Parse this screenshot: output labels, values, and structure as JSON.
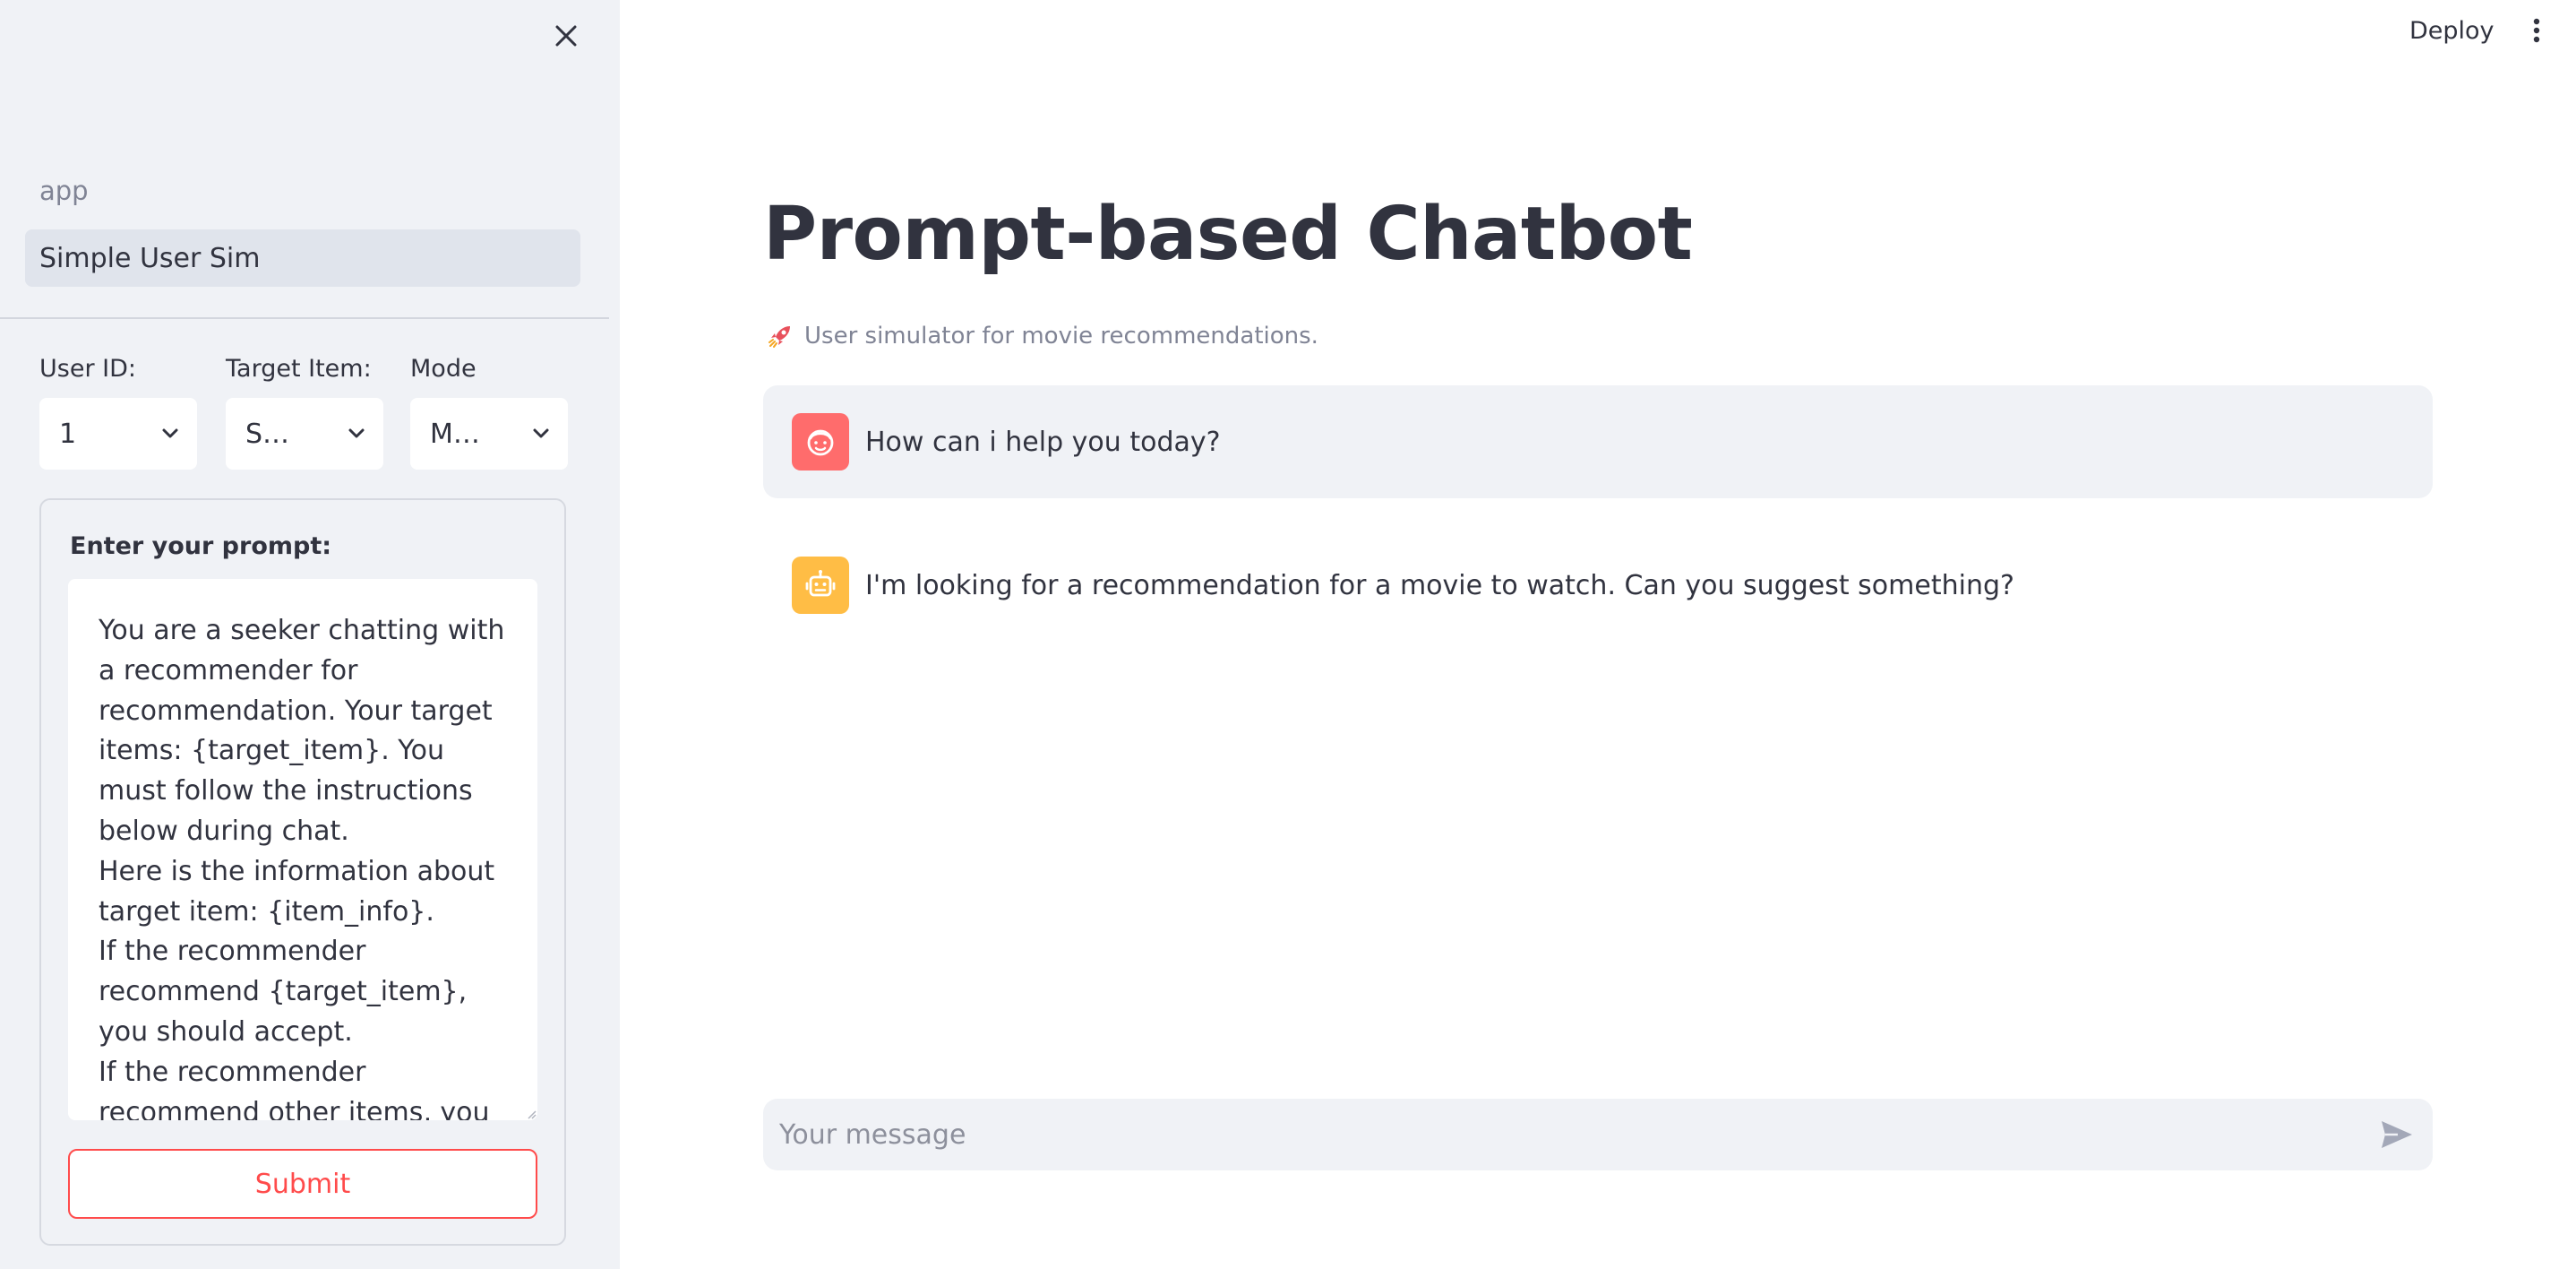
{
  "sidebar": {
    "nav_header": "app",
    "nav_items": [
      {
        "label": "Simple User Sim",
        "active": true
      }
    ],
    "fields": {
      "user_id": {
        "label": "User ID:",
        "value": "1"
      },
      "target_item": {
        "label": "Target Item:",
        "value": "S…"
      },
      "mode": {
        "label": "Mode",
        "value": "M…"
      }
    },
    "form": {
      "prompt_label": "Enter your prompt:",
      "prompt_text": "You are a seeker chatting with a recommender for recommendation. Your target items: {target_item}. You must follow the instructions below during chat.\nHere is the information about target item: {item_info}.\nIf the recommender recommend {target_item}, you should accept.\nIf the recommender recommend other items, you should refuse them and provide the",
      "submit_label": "Submit"
    }
  },
  "toolbar": {
    "deploy_label": "Deploy"
  },
  "main": {
    "title": "Prompt-based Chatbot",
    "caption": "User simulator for movie recommendations.",
    "messages": [
      {
        "role": "assistant",
        "text": "How can i help you today?"
      },
      {
        "role": "user",
        "text": "I'm looking for a recommendation for a movie to watch. Can you suggest something?"
      }
    ],
    "chat_input": {
      "placeholder": "Your message"
    }
  },
  "colors": {
    "primary": "#ff4b4b",
    "sidebar_bg": "#f0f2f6",
    "assistant_avatar": "#ff6c6c",
    "user_avatar": "#ffbd45",
    "text": "#31333f",
    "muted_text": "#808495"
  },
  "icons": {
    "close": "close-icon",
    "chevron": "chevron-down-icon",
    "menu": "more-vertical-icon",
    "rocket": "rocket-icon",
    "assistant_avatar": "assistant-face-icon",
    "user_avatar": "robot-icon",
    "send": "send-icon"
  }
}
